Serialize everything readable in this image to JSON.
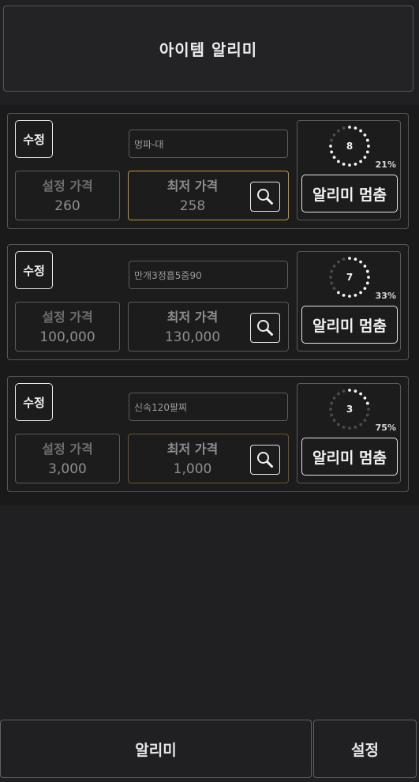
{
  "header": {
    "title": "아이템 알리미"
  },
  "labels": {
    "edit": "수정",
    "set_price": "설정 가격",
    "lowest_price": "최저 가격",
    "stop_alarm": "알리미 멈춤"
  },
  "items": [
    {
      "name": "멍파-대",
      "set_price": "260",
      "lowest_price": "258",
      "timer": "8",
      "progress_text": "21%",
      "progress": 0.79,
      "highlight": "bright"
    },
    {
      "name": "만개3정흡5줌90",
      "set_price": "100,000",
      "lowest_price": "130,000",
      "timer": "7",
      "progress_text": "33%",
      "progress": 0.67,
      "highlight": "none"
    },
    {
      "name": "신속120팔찌",
      "set_price": "3,000",
      "lowest_price": "1,000",
      "timer": "3",
      "progress_text": "75%",
      "progress": 0.25,
      "highlight": "dim"
    }
  ],
  "bottom_nav": {
    "alarm": "알리미",
    "settings": "설정"
  },
  "colors": {
    "highlight": "#c89a2c",
    "highlight_dim": "#6c5624",
    "background": "#202022"
  }
}
